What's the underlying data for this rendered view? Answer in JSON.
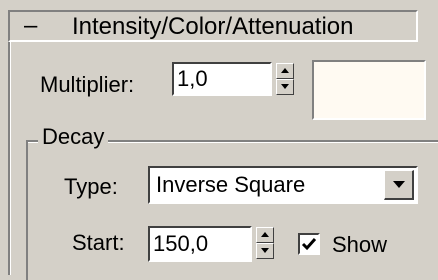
{
  "rollout": {
    "toggle_symbol": "–",
    "title": "Intensity/Color/Attenuation"
  },
  "multiplier": {
    "label": "Multiplier:",
    "value": "1,0"
  },
  "light_color": "#fffaf2",
  "decay": {
    "group_label": "Decay",
    "type_label": "Type:",
    "type_value": "Inverse Square",
    "start_label": "Start:",
    "start_value": "150,0",
    "show_label": "Show",
    "show_checked": true
  }
}
